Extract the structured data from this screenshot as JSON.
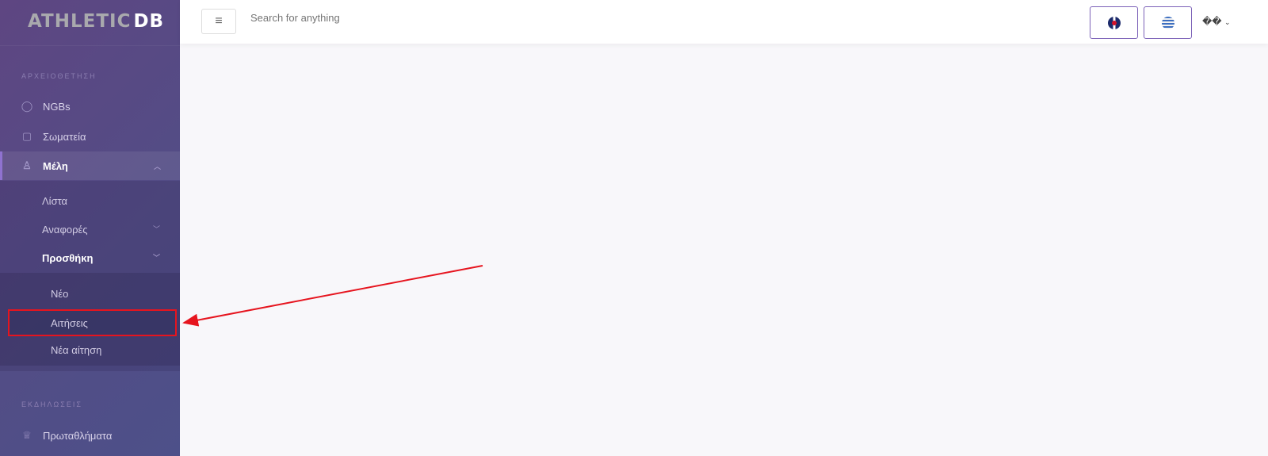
{
  "logo": {
    "part1": "ATHLETIC",
    "part2": "DB"
  },
  "sidebar": {
    "section1": "ΑΡΧΕΙΟΘΕΤΗΣΗ",
    "items": [
      {
        "label": "NGBs",
        "icon": "globe-icon"
      },
      {
        "label": "Σωματεία",
        "icon": "boxing-glove-icon"
      },
      {
        "label": "Μέλη",
        "icon": "person-icon"
      }
    ],
    "members_sub": [
      {
        "label": "Λίστα"
      },
      {
        "label": "Αναφορές"
      },
      {
        "label": "Προσθήκη"
      }
    ],
    "add_sub": [
      {
        "label": "Νέο"
      },
      {
        "label": "Αιτήσεις"
      },
      {
        "label": "Νέα αίτηση"
      }
    ],
    "section2": "ΕΚΔΗΛΩΣΕΙΣ",
    "events": [
      {
        "label": "Πρωταθλήματα",
        "icon": "trophy-icon"
      }
    ]
  },
  "header": {
    "search_placeholder": "Search for anything",
    "user_label": "��",
    "lang_en": "English",
    "lang_el": "Greek"
  },
  "annotation": {
    "color": "#e6141e"
  }
}
